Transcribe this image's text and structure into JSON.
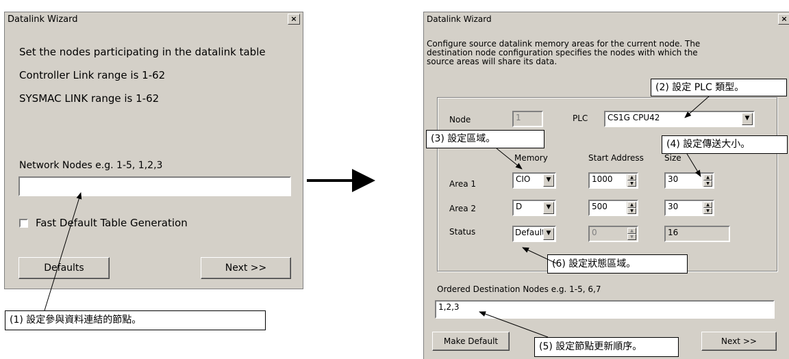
{
  "left_dialog": {
    "title": "Datalink Wizard",
    "close_glyph": "×",
    "line1": "Set the nodes participating in the datalink table",
    "line2": "Controller Link range is 1-62",
    "line3": "SYSMAC LINK range is 1-62",
    "nodes_label": "Network Nodes  e.g. 1-5, 1,2,3",
    "nodes_value": "",
    "checkbox_label": "Fast Default Table Generation",
    "checkbox_checked": false,
    "defaults_button": "Defaults",
    "next_button": "Next   >>"
  },
  "right_dialog": {
    "title": "Datalink Wizard",
    "close_glyph": "×",
    "description_line1": "Configure source datalink memory areas for the current node. The",
    "description_line2": "destination node configuration specifies the nodes with which the",
    "description_line3": "source areas will share its data.",
    "node_label": "Node",
    "node_value": "1",
    "plc_label": "PLC",
    "plc_value": "CS1G CPU42",
    "col_memory": "Memory",
    "col_start": "Start Address",
    "col_size": "Size",
    "rows": [
      {
        "label": "Area 1",
        "memory": "CIO",
        "start": "1000",
        "size": "30"
      },
      {
        "label": "Area 2",
        "memory": "D",
        "start": "500",
        "size": "30"
      },
      {
        "label": "Status",
        "memory": "Default",
        "start": "0",
        "size": "16"
      }
    ],
    "ordered_label": "Ordered Destination Nodes  e.g. 1-5, 6,7",
    "ordered_value": "1,2,3",
    "make_default_button": "Make Default",
    "next_button": "Next   >>"
  },
  "callouts": {
    "c1": "(1)  設定參與資料連結的節點。",
    "c2": "(2)  設定 PLC 類型。",
    "c3": "(3)  設定區域。",
    "c4": "(4)  設定傳送大小。",
    "c5": "(5)  設定節點更新順序。",
    "c6": "(6)  設定狀態區域。"
  },
  "icons": {
    "dropdown_arrow": "▼",
    "spin_up": "▲",
    "spin_down": "▼"
  }
}
